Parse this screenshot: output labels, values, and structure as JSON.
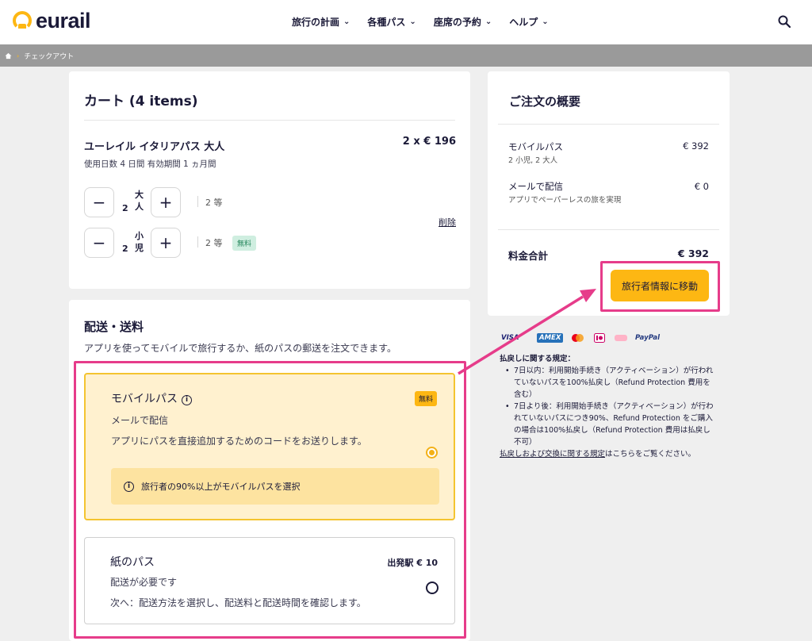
{
  "header": {
    "logo_text": "eurail",
    "nav": [
      {
        "label": "旅行の計画"
      },
      {
        "label": "各種パス"
      },
      {
        "label": "座席の予約"
      },
      {
        "label": "ヘルプ"
      }
    ]
  },
  "breadcrumb": {
    "current": "チェックアウト"
  },
  "cart": {
    "title": "カート (4 items)",
    "item": {
      "name": "ユーレイル イタリアパス 大人",
      "price": "2 x € 196",
      "sub": "使用日数 4 日間 有効期間 1 ヵ月間",
      "delete_label": "削除",
      "rows": [
        {
          "qty": "2",
          "label": "大人",
          "class": "2 等",
          "badge": ""
        },
        {
          "qty": "2",
          "label": "小児",
          "class": "2 等",
          "badge": "無料"
        }
      ]
    }
  },
  "delivery": {
    "title": "配送・送料",
    "subtitle": "アプリを使ってモバイルで旅行するか、紙のパスの郵送を注文できます。",
    "mobile": {
      "title": "モバイルパス",
      "badge": "無料",
      "line1": "メールで配信",
      "line2": "アプリにパスを直接追加するためのコードをお送りします。",
      "hint": "旅行者の90%以上がモバイルパスを選択"
    },
    "paper": {
      "title": "紙のパス",
      "price": "出発駅 € 10",
      "line1": "配送が必要です",
      "line2": "次へ：配送方法を選択し、配送料と配送時間を確認します。"
    }
  },
  "summary": {
    "title": "ご注文の概要",
    "rows": [
      {
        "label": "モバイルパス",
        "sub": "2 小児, 2 大人",
        "value": "€ 392"
      },
      {
        "label": "メールで配信",
        "sub": "アプリでペーパーレスの旅を実現",
        "value": "€ 0"
      }
    ],
    "total_label": "料金合計",
    "total_value": "€ 392",
    "cta_label": "旅行者情報に移動"
  },
  "payments": [
    "VISA",
    "AMEX",
    "Mastercard",
    "iDEAL",
    "Klarna",
    "PayPal"
  ],
  "payment_text": {
    "visa": "VISA",
    "amex": "AMEX",
    "paypal": "PayPal"
  },
  "refund": {
    "title": "払戻しに関する規定：",
    "items": [
      "7日以内：利用開始手続き（アクティベーション）が行われていないパスを100%払戻し（Refund Protection 費用を含む）",
      "7日より後：利用開始手続き（アクティベーション）が行われていないパスにつき90%、Refund Protection をご購入の場合は100%払戻し（Refund Protection 費用は払戻し不可）"
    ],
    "link_text": "払戻しおよび交換に関する規定",
    "link_suffix": "はこちらをご覧ください。"
  },
  "colors": {
    "brand": "#fdb713",
    "annotation": "#e63c8a",
    "navy": "#1b1a38"
  }
}
